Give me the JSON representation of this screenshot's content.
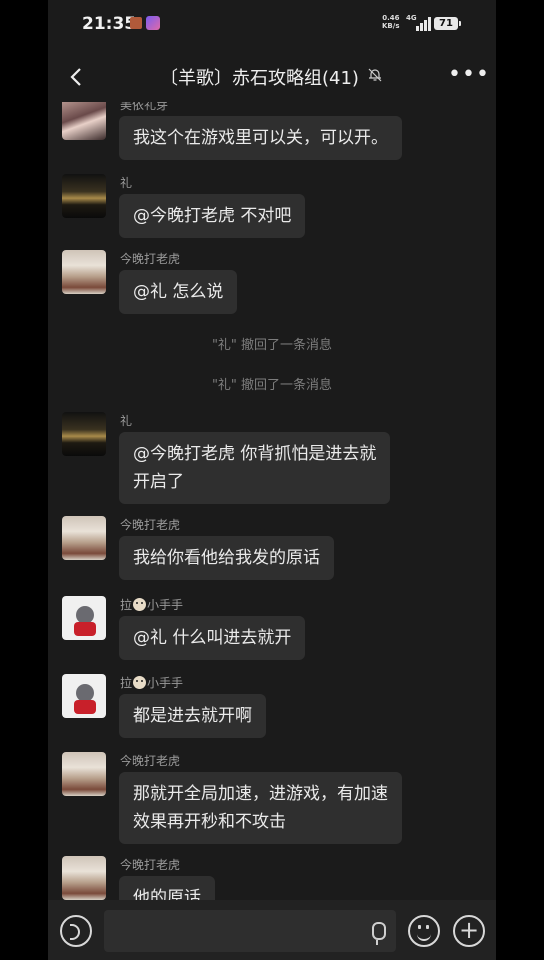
{
  "status_bar": {
    "time": "21:35",
    "net_speed": "0.46\nKB/s",
    "net_type": "4G",
    "battery": "71"
  },
  "header": {
    "title": "〔羊歌〕赤石攻略组(41)",
    "back_icon": "chevron-left-icon",
    "mute_icon": "bell-off-icon",
    "more_icon": "more-icon"
  },
  "messages": [
    {
      "sender": "美依礼芽",
      "avatar": "photo",
      "text": [
        "我这个在游戏里可以关，可以开。"
      ]
    },
    {
      "sender": "礼",
      "avatar": "dark",
      "text": [
        "@今晚打老虎  不对吧"
      ]
    },
    {
      "sender": "今晚打老虎",
      "avatar": "man",
      "text": [
        "@礼  怎么说"
      ]
    },
    {
      "system": "\"礼\" 撤回了一条消息"
    },
    {
      "system": "\"礼\" 撤回了一条消息"
    },
    {
      "sender": "礼",
      "avatar": "dark",
      "text": [
        "@今晚打老虎  你背抓怕是进去就",
        "开启了"
      ]
    },
    {
      "sender": "今晚打老虎",
      "avatar": "man",
      "text": [
        "我给你看他给我发的原话"
      ]
    },
    {
      "sender_pre": "拉",
      "sender_post": "小手手",
      "avatar": "cat",
      "text": [
        "@礼  什么叫进去就开"
      ]
    },
    {
      "sender_pre": "拉",
      "sender_post": "小手手",
      "avatar": "cat",
      "text": [
        "都是进去就开啊"
      ]
    },
    {
      "sender": "今晚打老虎",
      "avatar": "man",
      "text": [
        "那就开全局加速，进游戏，有加速",
        "效果再开秒和不攻击"
      ]
    },
    {
      "sender": "今晚打老虎",
      "avatar": "man",
      "text": [
        "他的原话"
      ]
    }
  ],
  "input_bar": {
    "voice_icon": "voice-icon",
    "mic_icon": "mic-icon",
    "emoji_icon": "emoji-icon",
    "plus_icon": "plus-icon"
  }
}
